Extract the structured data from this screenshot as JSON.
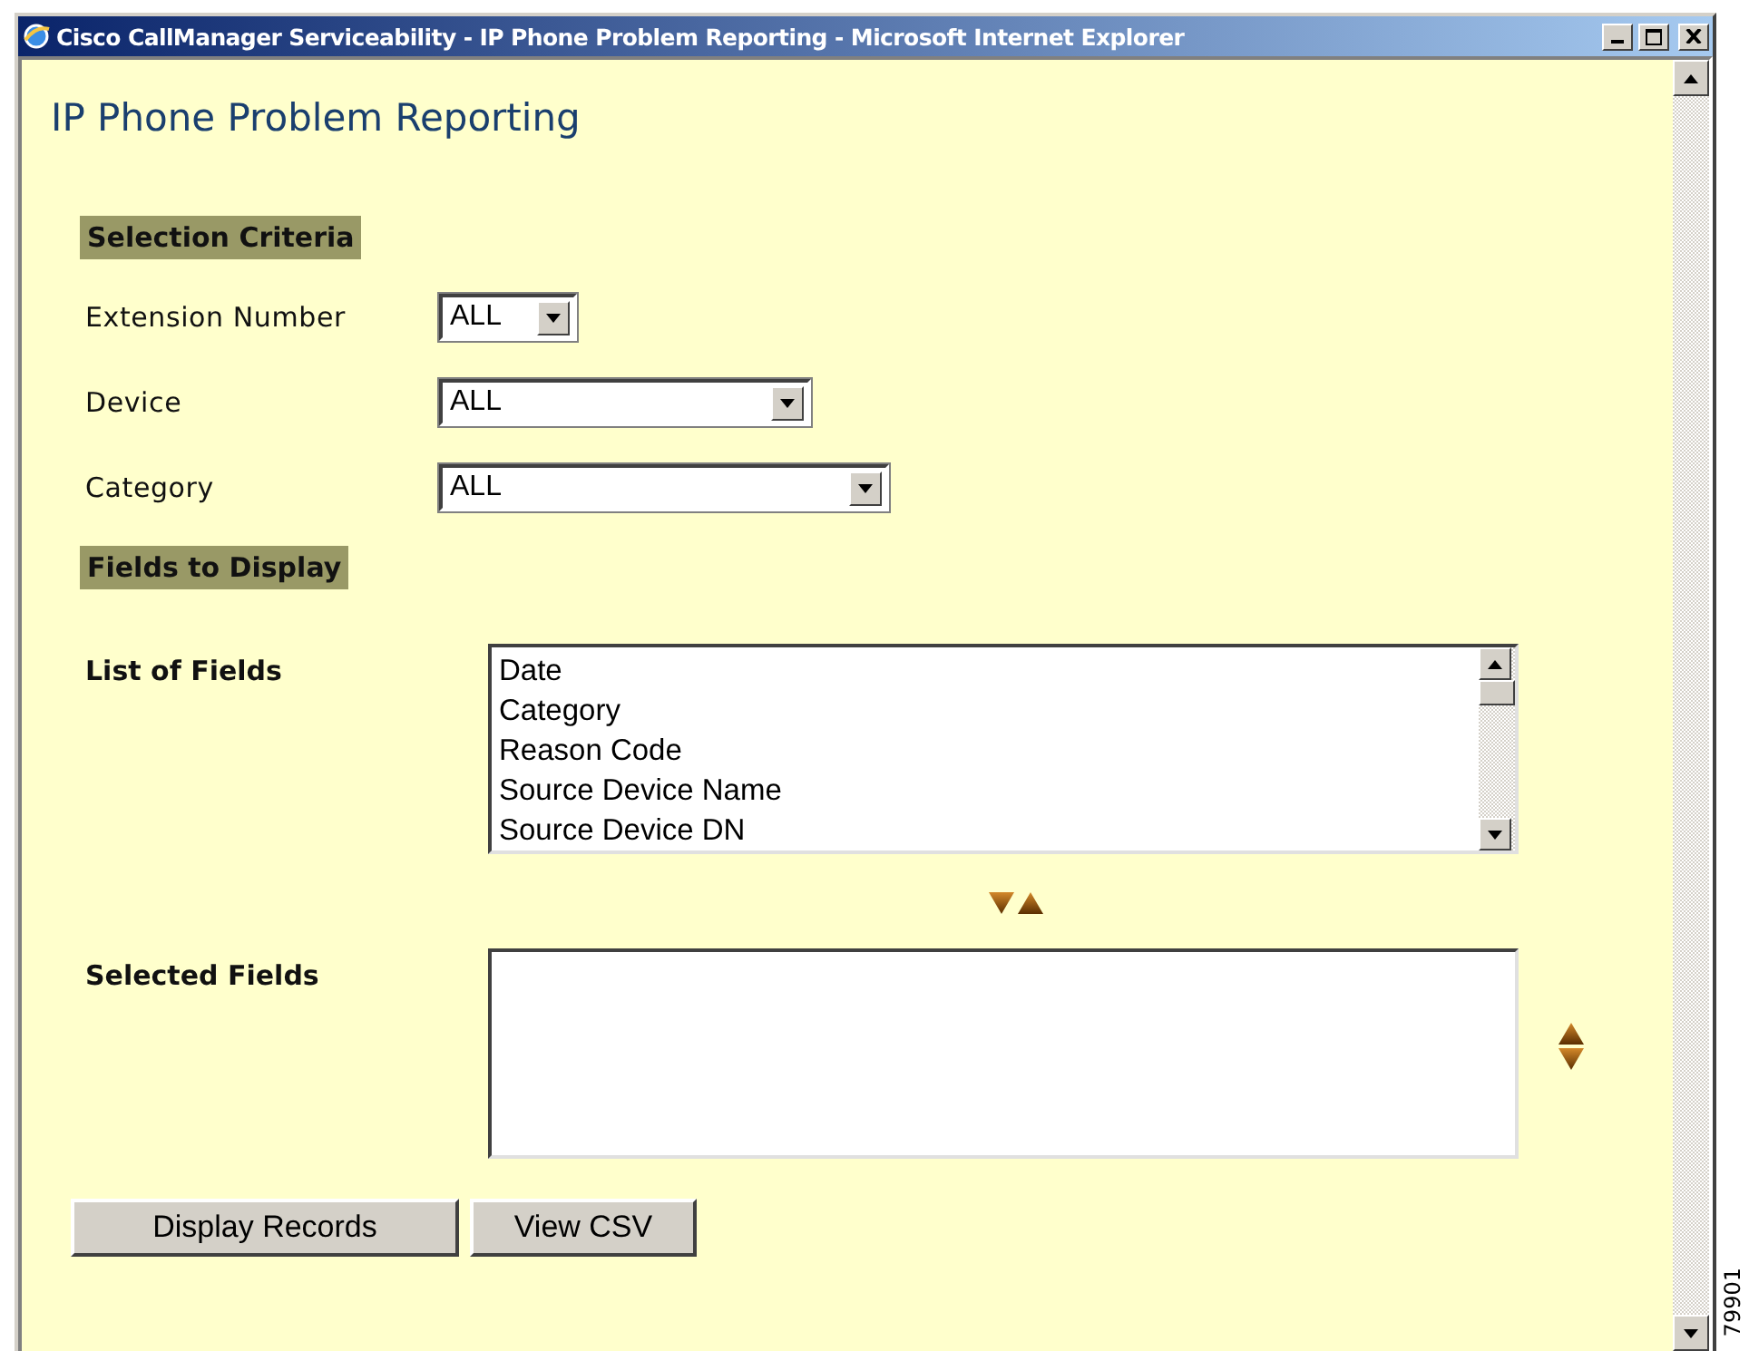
{
  "window": {
    "title": "Cisco CallManager Serviceability - IP Phone Problem Reporting - Microsoft Internet Explorer"
  },
  "heading": "IP Phone Problem Reporting",
  "selection_criteria": {
    "title": "Selection Criteria",
    "filters": [
      {
        "label": "Extension Number",
        "value": "ALL"
      },
      {
        "label": "Device",
        "value": "ALL"
      },
      {
        "label": "Category",
        "value": "ALL"
      }
    ]
  },
  "fields_to_display": {
    "title": "Fields to Display",
    "list_label": "List of Fields",
    "fields": [
      "Date",
      "Category",
      "Reason Code",
      "Source Device Name",
      "Source Device DN"
    ],
    "selected_label": "Selected Fields"
  },
  "buttons": [
    "Display Records",
    "View CSV"
  ],
  "figure_number": "79901"
}
